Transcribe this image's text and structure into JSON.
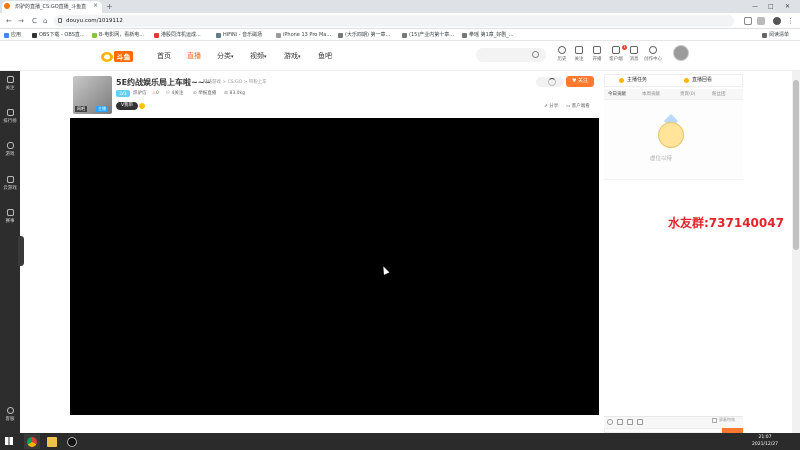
{
  "browser": {
    "tab_title": "炽驴的直播_CS:GO直播_斗鱼直",
    "tab_close": "×",
    "new_tab": "+",
    "win_min": "—",
    "win_max": "□",
    "win_close": "✕",
    "back": "←",
    "forward": "→",
    "reload": "C",
    "home": "⌂",
    "url": "douyu.com/1019112",
    "reading_list": "阅读清单",
    "bookmarks": [
      "应用",
      "OBS下载 - OBS直...",
      "B-电影网，看新电...",
      "港股同洋机运成...",
      "HiFiNi - 音乐磁场",
      "iPhone 13 Pro Ma...",
      "(大乐四期) 第一章...",
      "(15)产业内第十章...",
      "拳瑶 第1章_好剧_..."
    ]
  },
  "site": {
    "logo_text": "斗鱼",
    "nav": [
      {
        "label": "首页"
      },
      {
        "label": "直播"
      },
      {
        "label": "分类"
      },
      {
        "label": "视频"
      },
      {
        "label": "游戏"
      },
      {
        "label": "鱼吧"
      }
    ],
    "caret": "▾",
    "header_icons": [
      "历史",
      "关注",
      "开播",
      "客户端",
      "消息",
      "创作中心"
    ],
    "msg_badge": "1"
  },
  "sidebar": {
    "items": [
      "关注",
      "排行榜",
      "游戏",
      "云游戏",
      "赛事",
      "客服"
    ]
  },
  "room": {
    "title": "5E约战娱乐局上车啦~~~",
    "crumb": "网络游戏 > CS:GO > 带粉上车",
    "level": "LV3",
    "anchor": "炽驴信",
    "hot": "0",
    "followers": "4关注",
    "report": "举报直播",
    "weight": "83.0kg",
    "vbadge": "V我带",
    "thumb_tag1": "网吧",
    "thumb_tag2": "主播",
    "follow_btn": "关注",
    "share": "分享",
    "client_watch": "客户端看"
  },
  "right_panel": {
    "top_left": "主播任务",
    "top_right": "直播回看",
    "tabs": [
      "今日贡献",
      "本周贡献",
      "贵宾(0)",
      "粉丝团"
    ],
    "rank_empty": "虚位以待",
    "chat_hide_label": "屏蔽特效"
  },
  "watermark": "水友群:737140047",
  "taskbar": {
    "time": "21:07",
    "date": "2021/12/27"
  },
  "colors": {
    "accent": "#ff7a2f",
    "nav_active": "#ff5d23",
    "watermark": "#e0242a"
  }
}
